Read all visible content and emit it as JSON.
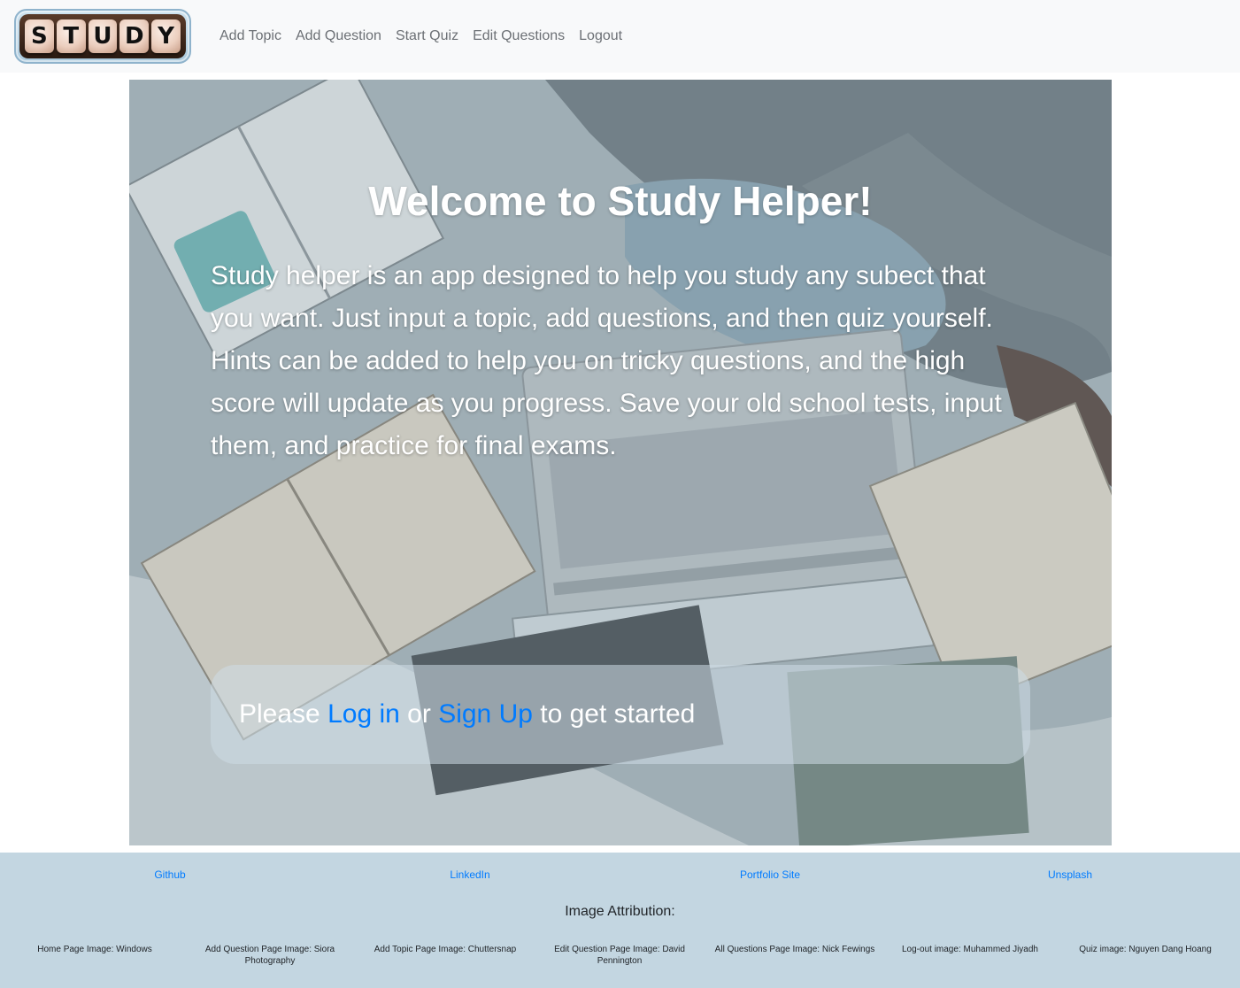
{
  "nav": {
    "logo_letters": [
      "S",
      "T",
      "U",
      "D",
      "Y"
    ],
    "links": [
      "Add Topic",
      "Add Question",
      "Start Quiz",
      "Edit Questions",
      "Logout"
    ]
  },
  "hero": {
    "title": "Welcome to Study Helper!",
    "description": "Study helper is an app designed to help you study any subect that you want. Just input a topic, add questions, and then quiz yourself. Hints can be added to help you on tricky questions, and the high score will update as you progress. Save your old school tests, input them, and practice for final exams.",
    "cta": {
      "prefix": "Please ",
      "login_label": "Log in",
      "middle": " or ",
      "signup_label": "Sign Up",
      "suffix": " to get started"
    }
  },
  "footer": {
    "links": [
      "Github",
      "LinkedIn",
      "Portfolio Site",
      "Unsplash"
    ],
    "attribution_heading": "Image Attribution:",
    "credits": [
      "Home Page Image: Windows",
      "Add Question Page Image: Siora Photography",
      "Add Topic Page Image: Chuttersnap",
      "Edit Question Page Image: David Pennington",
      "All Questions Page Image: Nick Fewings",
      "Log-out image: Muhammed Jiyadh",
      "Quiz image: Nguyen Dang Hoang"
    ]
  },
  "colors": {
    "link": "#007bff",
    "navbar_bg": "#f8f9fa",
    "footer_bg": "#c3d6e1",
    "nav_text": "#6c7075"
  }
}
